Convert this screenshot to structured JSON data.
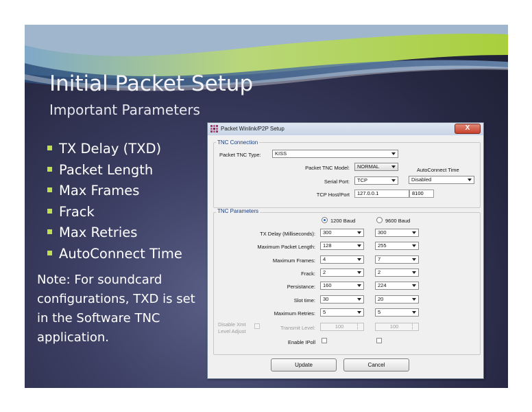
{
  "slide": {
    "title": "Initial Packet Setup",
    "subtitle": "Important Parameters",
    "bullets": [
      "TX Delay (TXD)",
      "Packet Length",
      "Max Frames",
      "Frack",
      "Max Retries",
      "AutoConnect Time"
    ],
    "note": "Note: For soundcard configurations, TXD is set in the Software TNC application.",
    "colors": {
      "background": "#2f3150",
      "bullet": "#bfe051",
      "swoosh_green": "#a9cf3c",
      "swoosh_blue": "#5c7fa8"
    }
  },
  "dialog": {
    "title": "Packet Winlink/P2P Setup",
    "close_label": "X",
    "tnc_connection": {
      "group_label": "TNC Connection",
      "type_label": "Packet TNC Type:",
      "type_value": "KISS",
      "model_label": "Packet TNC Model:",
      "model_value": "NORMAL",
      "autoconnect_label": "AutoConnect Time",
      "autoconnect_value": "Disabled",
      "serial_label": "Serial Port:",
      "serial_value": "TCP",
      "host_label": "TCP Host/Port",
      "host_value": "127.0.0.1",
      "port_value": "8100"
    },
    "tnc_parameters": {
      "group_label": "TNC Parameters",
      "baud_1200": "1200 Baud",
      "baud_9600": "9600 Baud",
      "rows": [
        {
          "label": "TX Delay (Milliseconds):",
          "v1200": "300",
          "v9600": "300"
        },
        {
          "label": "Maximum Packet Length:",
          "v1200": "128",
          "v9600": "255"
        },
        {
          "label": "Maximum Frames:",
          "v1200": "4",
          "v9600": "7"
        },
        {
          "label": "Frack:",
          "v1200": "2",
          "v9600": "2"
        },
        {
          "label": "Persistance:",
          "v1200": "160",
          "v9600": "224"
        },
        {
          "label": "Slot time:",
          "v1200": "30",
          "v9600": "20"
        },
        {
          "label": "Maximum Retries:",
          "v1200": "5",
          "v9600": "5"
        }
      ],
      "disable_xmt_label": "Disable Xmt Level Adjust",
      "transmit_level_label": "Transmit Level:",
      "transmit_1200": "100",
      "transmit_9600": "100",
      "ipoll_label": "Enable IPoll"
    },
    "buttons": {
      "update": "Update",
      "cancel": "Cancel"
    }
  }
}
